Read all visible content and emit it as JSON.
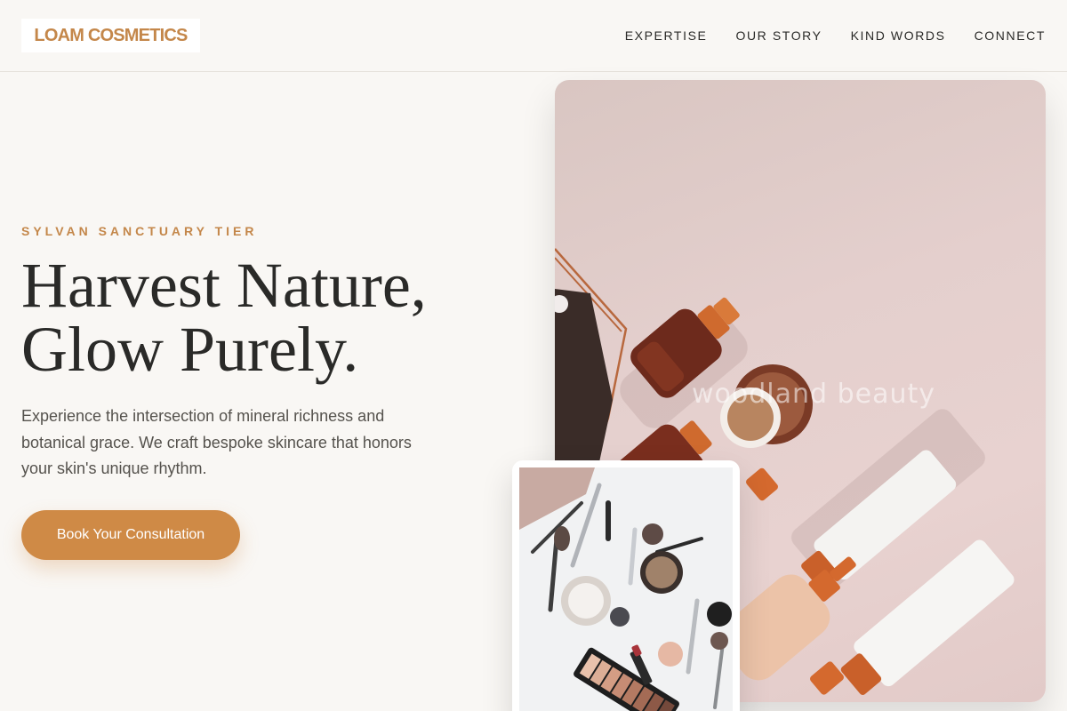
{
  "brand": {
    "logo_text": "LOAM COSMETICS"
  },
  "nav": {
    "items": [
      {
        "label": "EXPERTISE"
      },
      {
        "label": "OUR STORY"
      },
      {
        "label": "KIND WORDS"
      },
      {
        "label": "CONNECT"
      }
    ]
  },
  "hero": {
    "eyebrow": "SYLVAN SANCTUARY TIER",
    "headline_line1": "Harvest Nature,",
    "headline_line2": "Glow Purely.",
    "lead": "Experience the intersection of mineral richness and botanical grace. We craft bespoke skincare that honors your skin's unique rhythm.",
    "cta_label": "Book Your Consultation"
  },
  "media": {
    "main_image_watermark": "woodland beauty",
    "main_image_subject": "flat-lay of amber cosmetic bottles, compact and white tubes on pink",
    "inset_image_subject": "flat-lay of makeup brushes, eyeshadow palette, lipstick and compacts"
  },
  "colors": {
    "accent": "#c4874a",
    "button": "#cf8a46",
    "background": "#f9f7f4",
    "text": "#2a2a28"
  }
}
